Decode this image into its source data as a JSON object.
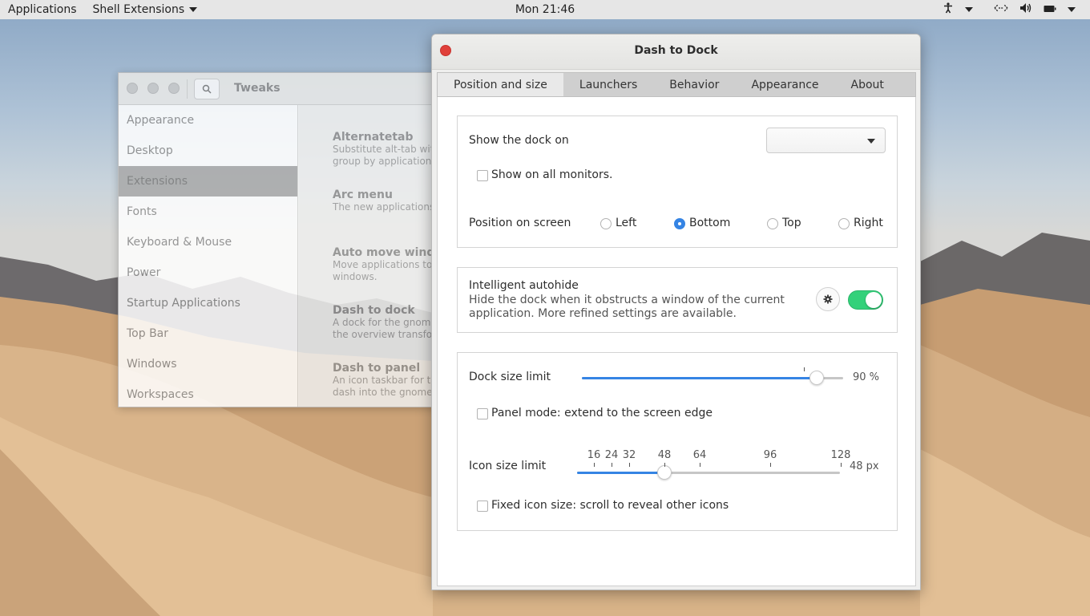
{
  "topbar": {
    "applications": "Applications",
    "shell_extensions": "Shell Extensions",
    "clock": "Mon 21:46",
    "icons": [
      "accessibility-icon",
      "network-icon",
      "volume-icon",
      "battery-icon",
      "power-menu-icon"
    ]
  },
  "tweaks": {
    "title": "Tweaks",
    "sidebar": [
      {
        "label": "Appearance"
      },
      {
        "label": "Desktop"
      },
      {
        "label": "Extensions",
        "active": true
      },
      {
        "label": "Fonts"
      },
      {
        "label": "Keyboard & Mouse"
      },
      {
        "label": "Power"
      },
      {
        "label": "Startup Applications"
      },
      {
        "label": "Top Bar"
      },
      {
        "label": "Windows"
      },
      {
        "label": "Workspaces"
      }
    ],
    "extensions": [
      {
        "name": "Alternatetab",
        "desc1": "Substitute alt-tab with",
        "desc2": "group by application."
      },
      {
        "name": "Arc menu",
        "desc1": "The new applications m",
        "desc2": ""
      },
      {
        "name": "Auto move windo",
        "desc1": "Move applications to sp",
        "desc2": "windows."
      },
      {
        "name": "Dash to dock",
        "desc1": "A dock for the gnome",
        "desc2": "the overview transform"
      },
      {
        "name": "Dash to panel",
        "desc1": "An icon taskbar for the",
        "desc2": "dash into the gnome m"
      }
    ]
  },
  "dtd": {
    "title": "Dash to Dock",
    "tabs": [
      "Position and size",
      "Launchers",
      "Behavior",
      "Appearance",
      "About"
    ],
    "active_tab": "Position and size",
    "show_dock_on": "Show the dock on",
    "show_dock_value": "",
    "show_all_monitors": "Show on all monitors.",
    "position_label": "Position on screen",
    "positions": [
      "Left",
      "Bottom",
      "Top",
      "Right"
    ],
    "position_selected": "Bottom",
    "autohide_title": "Intelligent autohide",
    "autohide_desc1": "Hide the dock when it obstructs a window of the current",
    "autohide_desc2": "application. More refined settings are available.",
    "autohide_enabled": true,
    "dock_size_label": "Dock size limit",
    "dock_size_value": "90 %",
    "dock_size_fraction": 0.9,
    "panel_mode": "Panel mode: extend to the screen edge",
    "icon_size_label": "Icon size limit",
    "icon_size_value": "48 px",
    "icon_size_marks": [
      "16",
      "24",
      "32",
      "48",
      "64",
      "96",
      "128"
    ],
    "icon_size_selected": 48,
    "fixed_icon": "Fixed icon size: scroll to reveal other icons"
  },
  "colors": {
    "accent": "#3584e4",
    "switch_on": "#33d17a",
    "close": "#e0403a"
  }
}
